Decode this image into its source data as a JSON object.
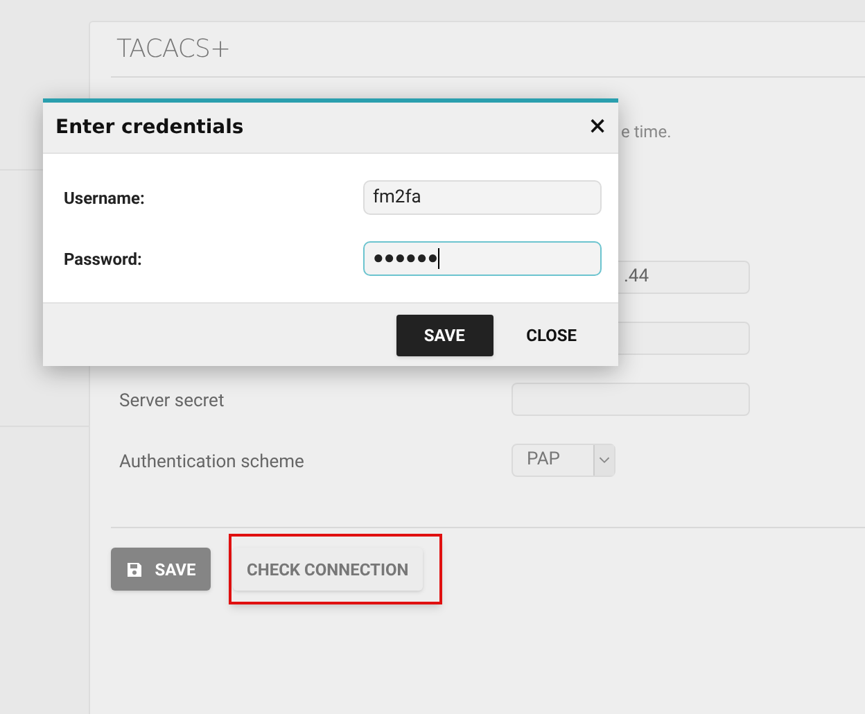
{
  "panel": {
    "title": "TACACS+",
    "description_fragment": "e time.",
    "fields": [
      {
        "kind": "input",
        "value": ".44"
      },
      {
        "kind": "input"
      },
      {
        "kind": "input",
        "label": "Server secret"
      },
      {
        "kind": "select",
        "label": "Authentication scheme",
        "value": "PAP"
      }
    ],
    "buttons": [
      {
        "kind": "save",
        "label": "SAVE",
        "highlighted": false
      },
      {
        "kind": "plain",
        "label": "CHECK CONNECTION",
        "highlighted": true
      }
    ]
  },
  "dialog": {
    "title": "Enter credentials",
    "close_glyph": "×",
    "fields": [
      {
        "label": "Username:",
        "value": "fm2fa",
        "focused": false
      },
      {
        "label": "Password:",
        "value": "●●●●●●",
        "focused": true
      }
    ],
    "buttons": [
      {
        "kind": "primary",
        "label": "SAVE"
      },
      {
        "kind": "flat",
        "label": "CLOSE"
      }
    ]
  }
}
